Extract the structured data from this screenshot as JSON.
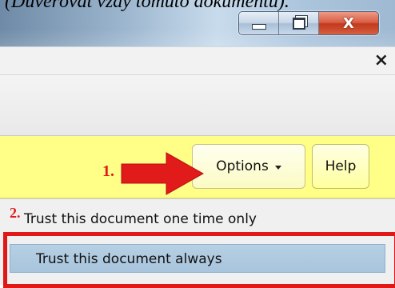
{
  "caption": {
    "text": "(Důvěřovat vždy tomuto dokumentu)."
  },
  "window": {
    "minimize_icon": "minimize-icon",
    "maximize_icon": "restore-icon",
    "close_icon": "close-icon",
    "close_glyph": "X"
  },
  "closebar": {
    "close_glyph": "×"
  },
  "security_bar": {
    "background": "#ffff88",
    "options_label": "Options",
    "help_label": "Help"
  },
  "annotations": {
    "step1": "1.",
    "step2": "2.",
    "color": "#e11a1a"
  },
  "menu": {
    "items": [
      {
        "label": "Trust this document one time only",
        "selected": false
      },
      {
        "label": "Trust this document always",
        "selected": true
      }
    ]
  }
}
